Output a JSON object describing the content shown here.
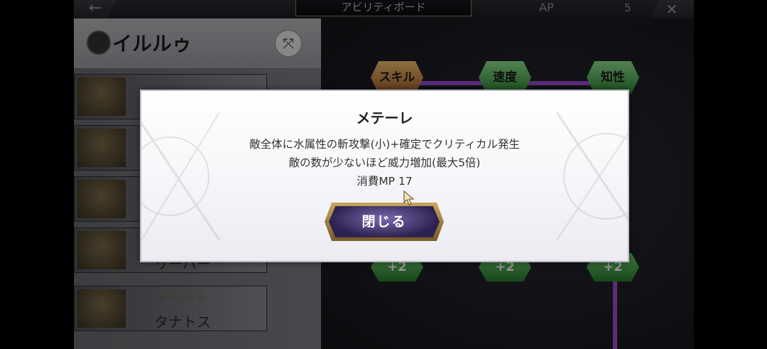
{
  "topbar": {
    "back_glyph": "←",
    "title": "アビリティボード",
    "ap_label": "AP",
    "ap_value": "5",
    "close_glyph": "✕"
  },
  "character": {
    "name": "イルルゥ",
    "icon": "character-emblem-icon",
    "swap_icon": "swap-icon"
  },
  "abilities": [
    {
      "label": "",
      "stars": ""
    },
    {
      "label": "",
      "stars": ""
    },
    {
      "label": "",
      "stars": ""
    },
    {
      "label": "リーバー",
      "stars": ""
    },
    {
      "label": "タナトス",
      "stars": "☆☆☆☆☆"
    }
  ],
  "board": {
    "nodes": [
      {
        "label": "スキル",
        "type": "skill"
      },
      {
        "label": "速度",
        "type": "stat"
      },
      {
        "label": "知性",
        "type": "stat"
      }
    ],
    "plus_nodes": [
      "+2",
      "+2",
      "+2"
    ]
  },
  "dialog": {
    "title": "メテーレ",
    "line1": "敵全体に水属性の斬攻撃(小)+確定でクリティカル発生",
    "line2": "敵の数が少ないほど威力増加(最大5倍)",
    "line3": "消費MP 17",
    "close_label": "閉じる"
  },
  "colors": {
    "dialog_bg": "#f5f4f8",
    "button_frame": "#c9a55a",
    "button_fill": "#2c2250",
    "link_purple": "#9c4fd0",
    "node_green": "#2f8a34"
  }
}
